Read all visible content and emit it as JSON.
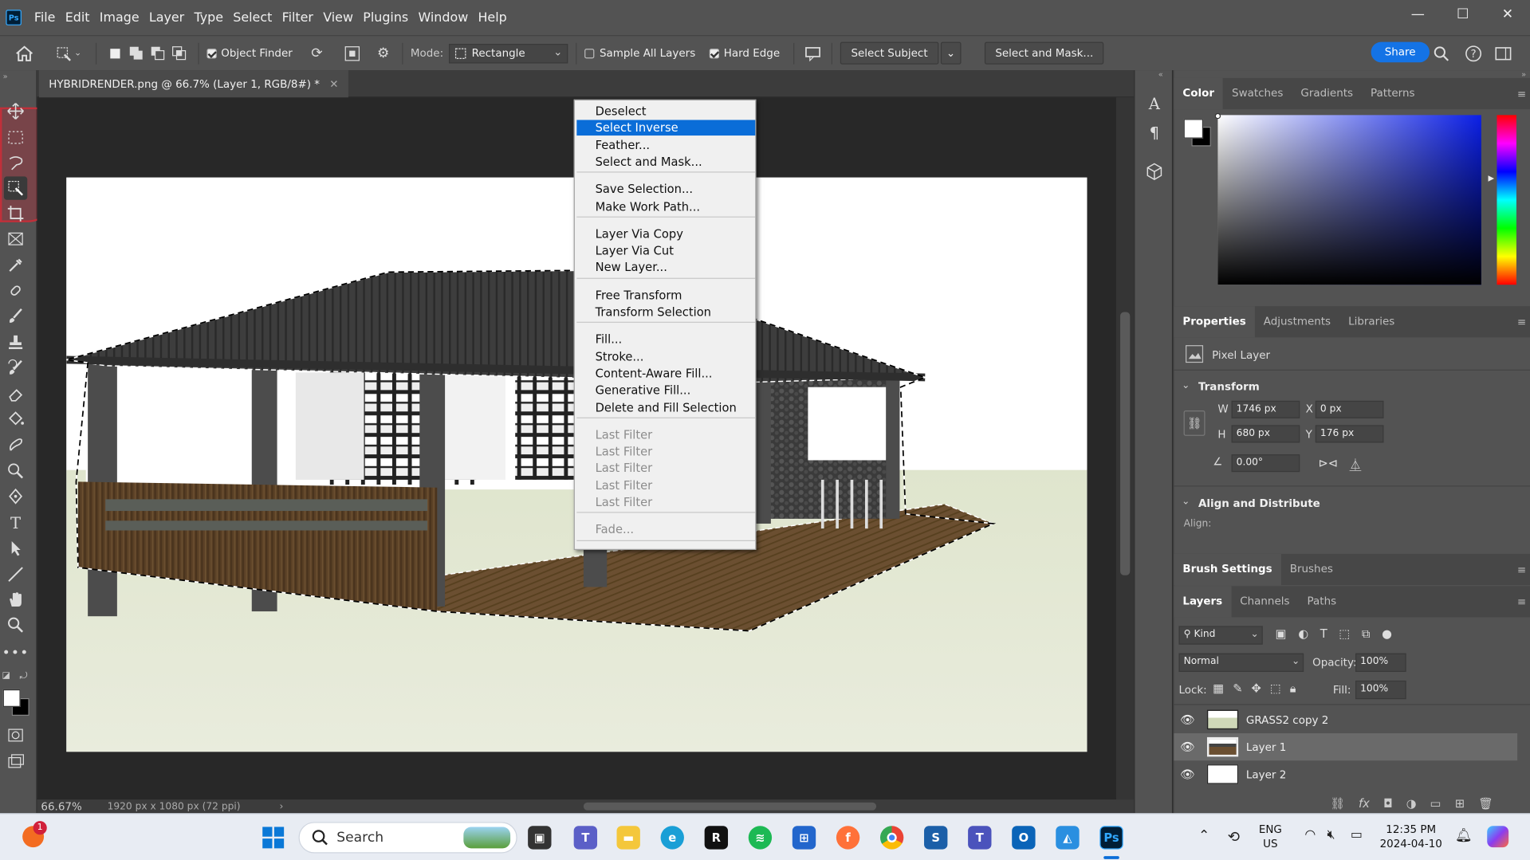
{
  "app": {
    "logo": "Ps",
    "menu": [
      "File",
      "Edit",
      "Image",
      "Layer",
      "Type",
      "Select",
      "Filter",
      "View",
      "Plugins",
      "Window",
      "Help"
    ],
    "window_controls": [
      "—",
      "☐",
      "✕"
    ]
  },
  "options_bar": {
    "object_finder_label": "Object Finder",
    "object_finder_checked": true,
    "mode_label": "Mode:",
    "mode_value": "Rectangle",
    "sample_all_layers_label": "Sample All Layers",
    "sample_all_layers_checked": false,
    "hard_edge_label": "Hard Edge",
    "hard_edge_checked": true,
    "select_subject_label": "Select Subject",
    "select_and_mask_label": "Select and Mask...",
    "share_label": "Share"
  },
  "document": {
    "tab_title": "HYBRIDRENDER.png @ 66.7% (Layer 1, RGB/8#) *",
    "zoom": "66.67%",
    "dimensions": "1920 px x 1080 px (72 ppi)"
  },
  "context_menu": {
    "items": [
      {
        "label": "Deselect",
        "state": "normal"
      },
      {
        "label": "Select Inverse",
        "state": "selected"
      },
      {
        "label": "Feather...",
        "state": "normal"
      },
      {
        "label": "Select and Mask...",
        "state": "normal"
      },
      {
        "label": "Save Selection...",
        "state": "normal"
      },
      {
        "label": "Make Work Path...",
        "state": "normal"
      },
      {
        "label": "Layer Via Copy",
        "state": "normal"
      },
      {
        "label": "Layer Via Cut",
        "state": "normal"
      },
      {
        "label": "New Layer...",
        "state": "normal"
      },
      {
        "label": "Free Transform",
        "state": "normal"
      },
      {
        "label": "Transform Selection",
        "state": "normal"
      },
      {
        "label": "Fill...",
        "state": "normal"
      },
      {
        "label": "Stroke...",
        "state": "normal"
      },
      {
        "label": "Content-Aware Fill...",
        "state": "normal"
      },
      {
        "label": "Generative Fill...",
        "state": "normal"
      },
      {
        "label": "Delete and Fill Selection",
        "state": "normal"
      },
      {
        "label": "Last Filter",
        "state": "disabled"
      },
      {
        "label": "Last Filter",
        "state": "disabled"
      },
      {
        "label": "Last Filter",
        "state": "disabled"
      },
      {
        "label": "Last Filter",
        "state": "disabled"
      },
      {
        "label": "Last Filter",
        "state": "disabled"
      },
      {
        "label": "Fade...",
        "state": "disabled"
      }
    ]
  },
  "color_panel": {
    "tabs": [
      "Color",
      "Swatches",
      "Gradients",
      "Patterns"
    ],
    "foreground": "#ffffff",
    "background": "#000000"
  },
  "properties_panel": {
    "tabs": [
      "Properties",
      "Adjustments",
      "Libraries"
    ],
    "layer_type": "Pixel Layer",
    "transform_title": "Transform",
    "w_label": "W",
    "w_value": "1746 px",
    "x_label": "X",
    "x_value": "0 px",
    "h_label": "H",
    "h_value": "680 px",
    "y_label": "Y",
    "y_value": "176 px",
    "angle_value": "0.00°",
    "align_title": "Align and Distribute",
    "align_label": "Align:"
  },
  "brush_panel": {
    "tabs": [
      "Brush Settings",
      "Brushes"
    ]
  },
  "layers_panel": {
    "tabs": [
      "Layers",
      "Channels",
      "Paths"
    ],
    "kind_label": "Kind",
    "blend_mode": "Normal",
    "opacity_label": "Opacity:",
    "opacity_value": "100%",
    "lock_label": "Lock:",
    "fill_label": "Fill:",
    "fill_value": "100%",
    "layers": [
      {
        "name": "GRASS2 copy 2",
        "selected": false
      },
      {
        "name": "Layer 1",
        "selected": true
      },
      {
        "name": "Layer 2",
        "selected": false
      }
    ]
  },
  "taskbar": {
    "search_placeholder": "Search",
    "lang_top": "ENG",
    "lang_bottom": "US",
    "time": "12:35 PM",
    "date": "2024-04-10",
    "notification_badge": "1"
  }
}
